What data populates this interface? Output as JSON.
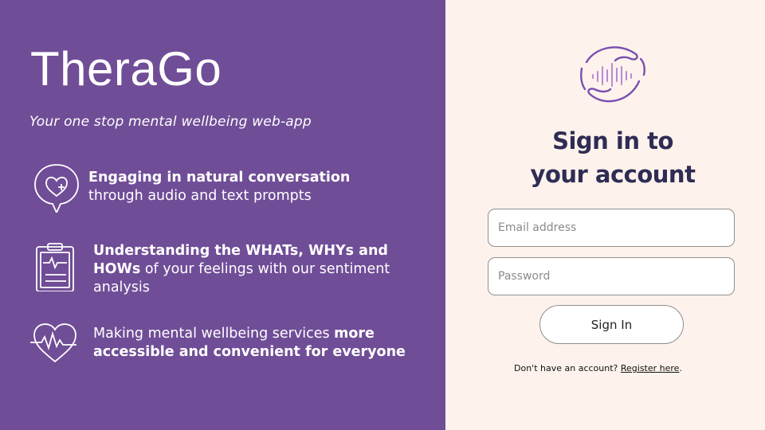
{
  "brand": {
    "name": "TheraGo",
    "tagline": "Your one stop mental wellbeing web-app"
  },
  "features": [
    {
      "icon": "heart-chat-icon",
      "bold": "Engaging in natural conversation",
      "rest": " through audio and text prompts"
    },
    {
      "icon": "clipboard-pulse-icon",
      "bold": "Understanding the WHATs, WHYs and HOWs",
      "rest": " of your feelings with our sentiment analysis"
    },
    {
      "icon": "heart-pulse-icon",
      "lead": "Making mental wellbeing services ",
      "bold": "more accessible and convenient for everyone"
    }
  ],
  "signin": {
    "logo_icon": "hands-soundwave-logo",
    "title_line1": "Sign in to",
    "title_line2": "your account",
    "email_placeholder": "Email address",
    "password_placeholder": "Password",
    "button_label": "Sign In",
    "register_prompt": "Don't have an account?",
    "register_link": "Register here",
    "register_suffix": "."
  },
  "colors": {
    "left_panel": "#704d97",
    "right_panel": "#fdf3ec",
    "title": "#2f2c55",
    "logo_accent": "#8a5cc0"
  }
}
